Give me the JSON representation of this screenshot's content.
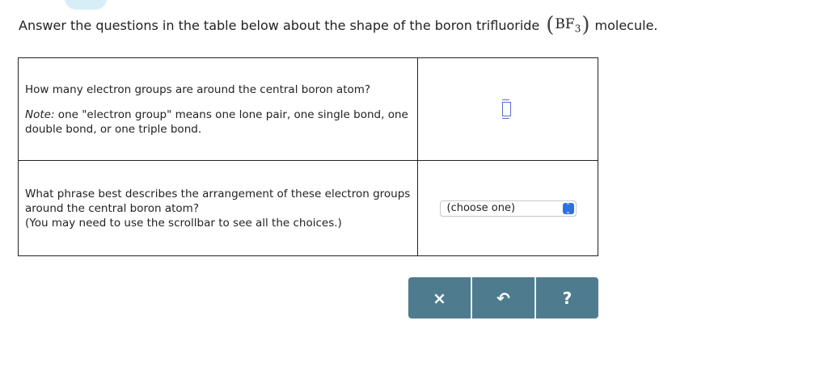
{
  "prompt": {
    "text_before": "Answer the questions in the table below about the shape of the boron trifluoride",
    "formula_base": "BF",
    "formula_sub": "3",
    "text_after": "molecule."
  },
  "rows": [
    {
      "question": "How many electron groups are around the central boron atom?",
      "note_label": "Note:",
      "note_text": " one \"electron group\" means one lone pair, one single bond, one double bond, or one triple bond.",
      "answer_value": ""
    },
    {
      "question_line1": "What phrase best describes the arrangement of these electron groups around the central boron atom?",
      "question_line2": "(You may need to use the scrollbar to see all the choices.)",
      "select_value": "(choose one)"
    }
  ],
  "toolbar": {
    "clear_glyph": "×",
    "undo_glyph": "↶",
    "help_glyph": "?"
  },
  "colors": {
    "toolbar_bg": "#4e7c8e",
    "input_border": "#5a6bd0",
    "select_arrow": "#2f6fe6"
  }
}
